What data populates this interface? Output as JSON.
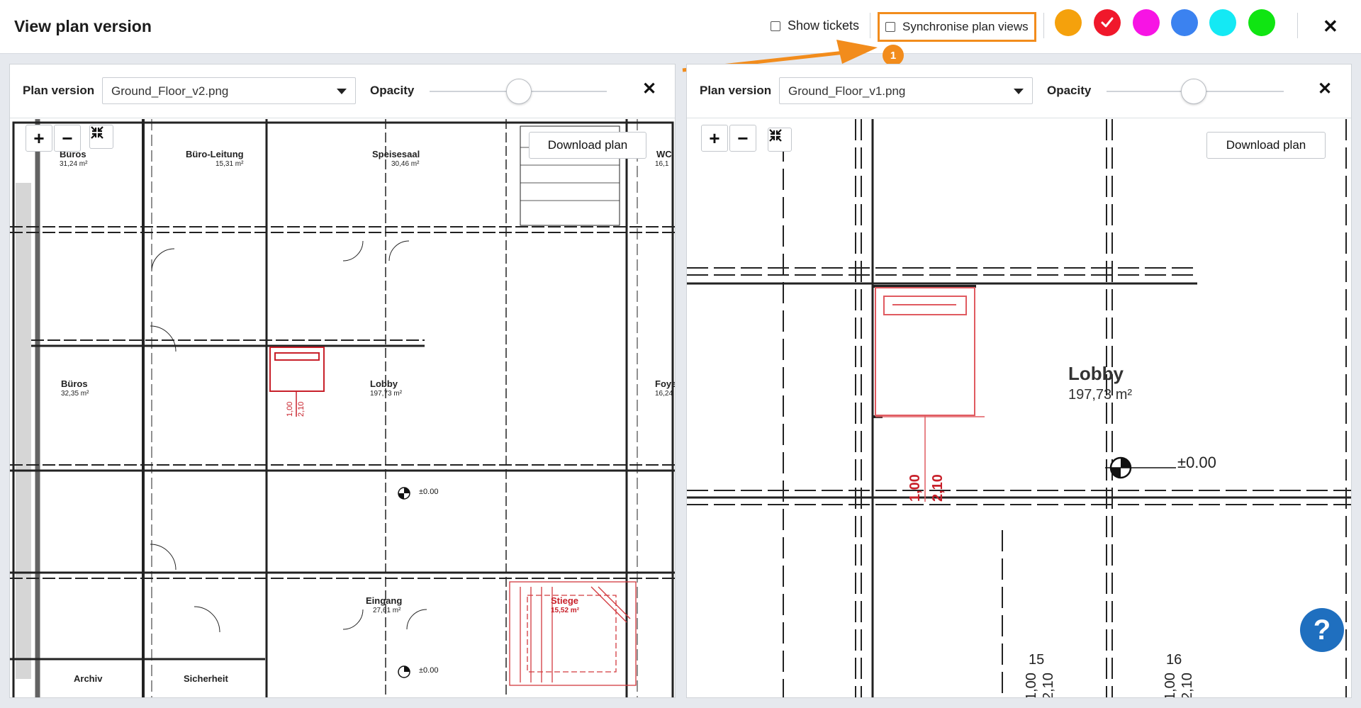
{
  "header": {
    "title": "View plan version",
    "show_tickets_label": "Show tickets",
    "sync_label": "Synchronise plan views",
    "callout_number": "1",
    "swatch_colors": [
      "#f5a10c",
      "#f0182b",
      "#f714e4",
      "#3b82f0",
      "#14e9f4",
      "#10e512"
    ]
  },
  "left_panel": {
    "plan_version_label": "Plan version",
    "selected_file": "Ground_Floor_v2.png",
    "opacity_label": "Opacity",
    "download_label": "Download plan",
    "rooms": [
      {
        "name": "Büros",
        "area": "31,24 m²"
      },
      {
        "name": "Büro-Leitung",
        "area": "15,31 m²"
      },
      {
        "name": "Speisesaal",
        "area": "30,46 m²"
      },
      {
        "name": "WC",
        "area": "16,1"
      },
      {
        "name": "Büros",
        "area": "32,35 m²"
      },
      {
        "name": "Lobby",
        "area": "197,73 m²"
      },
      {
        "name": "Foye",
        "area": "16,24"
      },
      {
        "name": "Eingang",
        "area": "27,61 m²"
      },
      {
        "name": "Stiege",
        "area": "15,52 m²"
      },
      {
        "name": "Archiv",
        "area": ""
      },
      {
        "name": "Sicherheit",
        "area": ""
      }
    ]
  },
  "right_panel": {
    "plan_version_label": "Plan version",
    "selected_file": "Ground_Floor_v1.png",
    "opacity_label": "Opacity",
    "download_label": "Download plan",
    "lobby_name": "Lobby",
    "lobby_area": "197,73 m²",
    "level_mark": "±0.00",
    "door_numbers": [
      "15",
      "16"
    ]
  },
  "zoom": {
    "plus": "+",
    "minus": "−"
  },
  "help_label": "?"
}
